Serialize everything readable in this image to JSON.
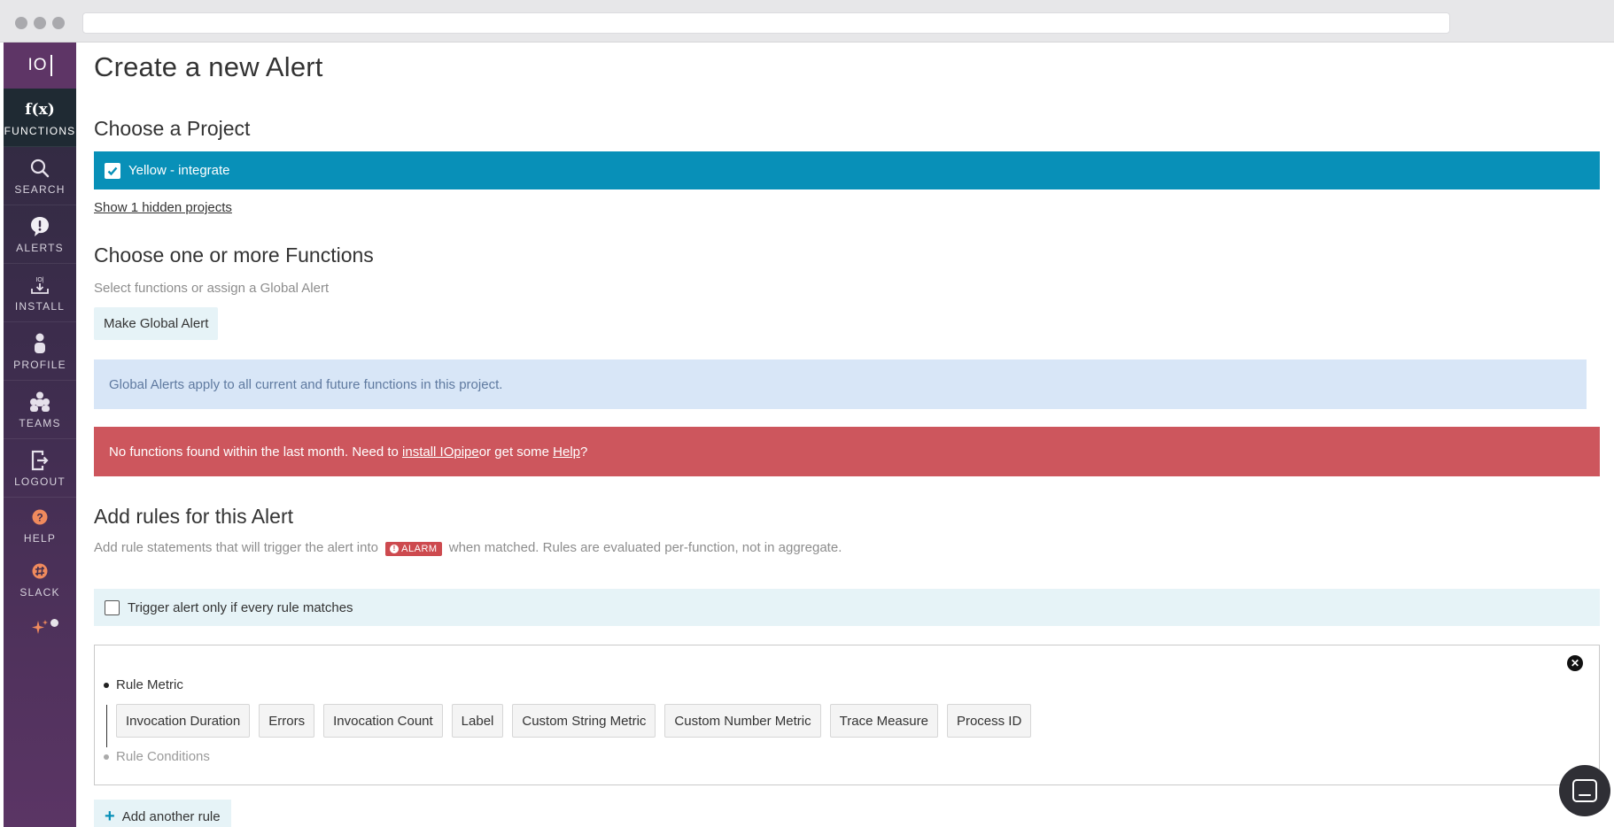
{
  "sidebar": {
    "logo": "IO",
    "items": [
      {
        "label": "FUNCTIONS",
        "icon": "fx-icon",
        "glyph": "f(x)"
      },
      {
        "label": "SEARCH",
        "icon": "search-icon"
      },
      {
        "label": "ALERTS",
        "icon": "alert-icon"
      },
      {
        "label": "INSTALL",
        "icon": "install-icon"
      },
      {
        "label": "PROFILE",
        "icon": "profile-icon"
      },
      {
        "label": "TEAMS",
        "icon": "teams-icon"
      },
      {
        "label": "LOGOUT",
        "icon": "logout-icon"
      },
      {
        "label": "HELP",
        "icon": "help-icon"
      },
      {
        "label": "SLACK",
        "icon": "slack-icon"
      }
    ],
    "sparkle_icon": "sparkle-icon"
  },
  "page": {
    "title": "Create a new Alert"
  },
  "project": {
    "heading": "Choose a Project",
    "selected": "Yellow - integrate",
    "hidden_link": "Show 1 hidden projects"
  },
  "functions": {
    "heading": "Choose one or more Functions",
    "subtext": "Select functions or assign a Global Alert",
    "global_button": "Make Global Alert",
    "info": "Global Alerts apply to all current and future functions in this project.",
    "error_prefix": "No functions found within the last month. Need to ",
    "error_link1": "install IOpipe",
    "error_middle": " or get some ",
    "error_link2": "Help",
    "error_suffix": "?"
  },
  "rules": {
    "heading": "Add rules for this Alert",
    "subtext_before": "Add rule statements that will trigger the alert into",
    "alarm_badge": "ALARM",
    "subtext_after": "when matched. Rules are evaluated per-function, not in aggregate.",
    "trigger_label": "Trigger alert only if every rule matches",
    "rule_metric_label": "Rule Metric",
    "rule_conditions_label": "Rule Conditions",
    "metrics": [
      "Invocation Duration",
      "Errors",
      "Invocation Count",
      "Label",
      "Custom String Metric",
      "Custom Number Metric",
      "Trace Measure",
      "Process ID"
    ],
    "add_rule": "Add another rule"
  },
  "colors": {
    "project_bar": "#0890b8",
    "error_bar": "#cd565d",
    "info_bar": "#d8e6f7",
    "sidebar_active": "#1f2a33",
    "sidebar_logo": "#5e3566"
  }
}
